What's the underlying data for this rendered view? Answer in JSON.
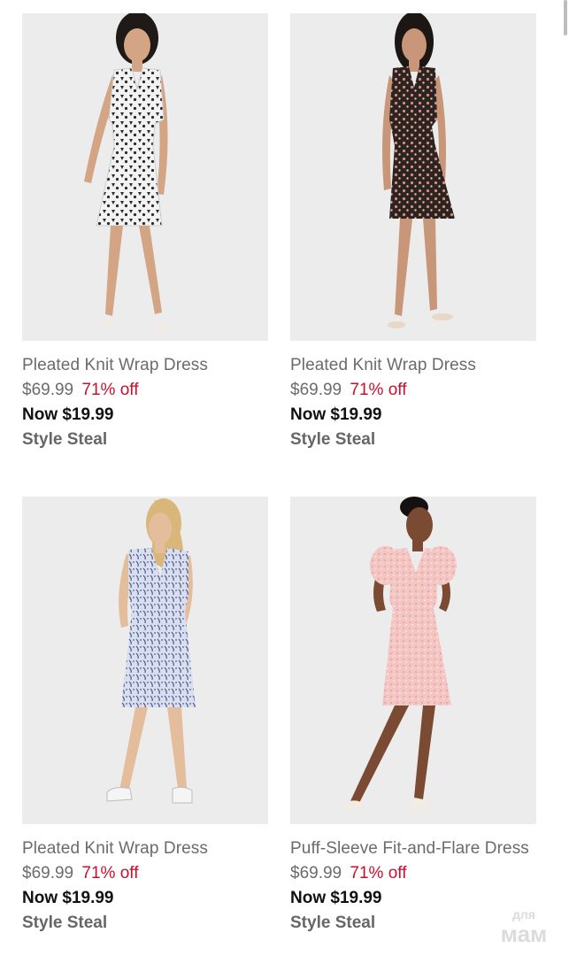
{
  "products": [
    {
      "name": "Pleated Knit Wrap Dress",
      "original_price": "$69.99",
      "discount": "71% off",
      "now_price": "Now $19.99",
      "tag": "Style Steal",
      "dress_color": "#f2f2f2",
      "pattern_color": "#2a2a2a"
    },
    {
      "name": "Pleated Knit Wrap Dress",
      "original_price": "$69.99",
      "discount": "71% off",
      "now_price": "Now $19.99",
      "tag": "Style Steal",
      "dress_color": "#2b2422",
      "pattern_color": "#d98c7a"
    },
    {
      "name": "Pleated Knit Wrap Dress",
      "original_price": "$69.99",
      "discount": "71% off",
      "now_price": "Now $19.99",
      "tag": "Style Steal",
      "dress_color": "#d9dfee",
      "pattern_color": "#4a5a8c"
    },
    {
      "name": "Puff-Sleeve Fit-and-Flare Dress",
      "original_price": "$69.99",
      "discount": "71% off",
      "now_price": "Now $19.99",
      "tag": "Style Steal",
      "dress_color": "#f3c6c3",
      "pattern_color": "#e8938e"
    }
  ],
  "watermark": "для мам",
  "colors": {
    "discount": "#c8102e",
    "name": "#6b6b6b",
    "now": "#111111",
    "photo_bg": "#ececed"
  }
}
